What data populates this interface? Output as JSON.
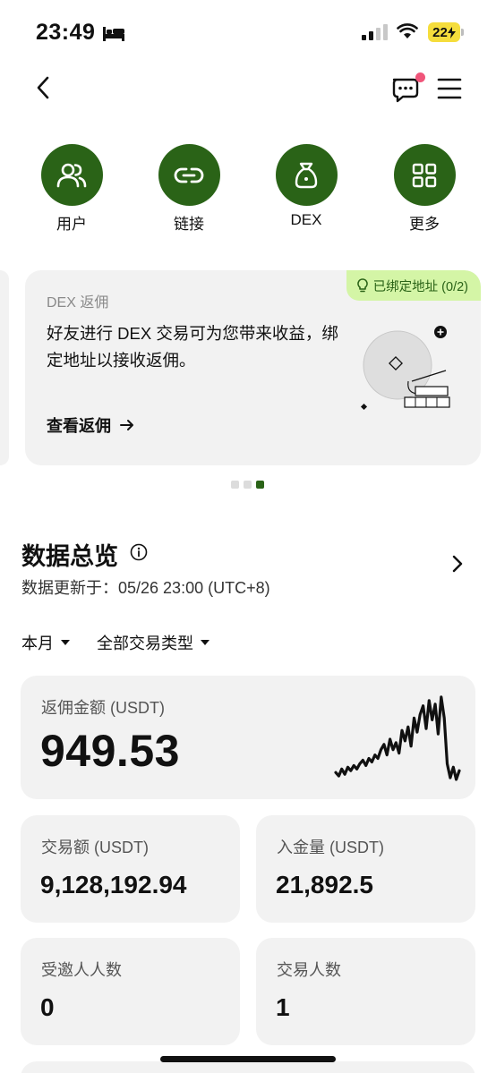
{
  "status_bar": {
    "time": "23:49",
    "battery": "22",
    "icons": [
      "bed-icon",
      "signal-icon",
      "wifi-icon",
      "battery-charging-icon"
    ]
  },
  "nav": {
    "icons": [
      "back-chevron-icon",
      "chat-bubble-icon",
      "menu-icon"
    ],
    "has_unread_dot": true
  },
  "quick_actions": [
    {
      "label": "用户",
      "icon": "users-icon"
    },
    {
      "label": "链接",
      "icon": "link-icon"
    },
    {
      "label": "DEX",
      "icon": "bag-icon"
    },
    {
      "label": "更多",
      "icon": "grid-icon"
    }
  ],
  "promo": {
    "tag": "DEX 返佣",
    "badge": "已绑定地址 (0/2)",
    "text": "好友进行 DEX 交易可为您带来收益，绑定地址以接收返佣。",
    "link": "查看返佣",
    "page_count": 3,
    "active_page": 3
  },
  "overview": {
    "title": "数据总览",
    "updated": "数据更新于：05/26 23:00 (UTC+8)",
    "filters": [
      "本月",
      "全部交易类型"
    ]
  },
  "stats": {
    "rebate": {
      "label": "返佣金额 (USDT)",
      "value": "949.53"
    },
    "volume": {
      "label": "交易额 (USDT)",
      "value": "9,128,192.94"
    },
    "deposit": {
      "label": "入金量 (USDT)",
      "value": "21,892.5"
    },
    "invited": {
      "label": "受邀人人数",
      "value": "0"
    },
    "traders": {
      "label": "交易人数",
      "value": "1"
    }
  },
  "theme": {
    "accent": "#2a6317",
    "badge_bg": "#d4f5a6",
    "card_bg": "#f2f2f2",
    "notification_dot": "#f0557a"
  },
  "chart_data": {
    "type": "line",
    "title": "",
    "xlabel": "",
    "ylabel": "",
    "grid": false,
    "x": [
      1,
      2,
      3,
      4,
      5,
      6,
      7,
      8,
      9,
      10,
      11,
      12,
      13,
      14,
      15,
      16,
      17,
      18,
      19,
      20,
      21,
      22,
      23,
      24,
      25,
      26,
      27,
      28,
      29,
      30,
      31,
      32,
      33,
      34,
      35,
      36,
      37,
      38,
      39,
      40,
      41,
      42
    ],
    "values": [
      10,
      6,
      14,
      8,
      16,
      12,
      18,
      14,
      20,
      24,
      18,
      26,
      22,
      30,
      26,
      36,
      42,
      30,
      48,
      36,
      44,
      32,
      58,
      46,
      62,
      40,
      72,
      56,
      76,
      86,
      60,
      92,
      70,
      88,
      54,
      96,
      72,
      20,
      4,
      16,
      2,
      12
    ],
    "ylim": [
      0,
      100
    ]
  }
}
